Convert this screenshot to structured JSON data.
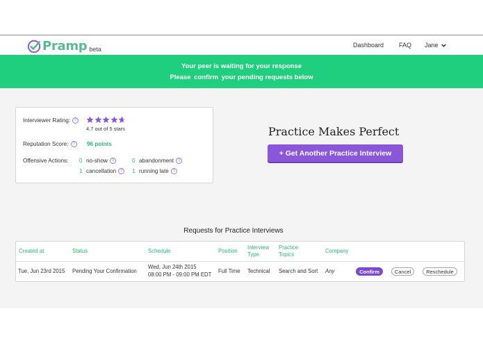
{
  "colors": {
    "brand_green": "#1fcf7d",
    "accent_purple": "#8a57d8",
    "link_green": "#2ab673"
  },
  "nav": {
    "logo_text": "Pramp",
    "logo_badge": "beta",
    "dashboard": "Dashboard",
    "faq": "FAQ",
    "user": "Jane",
    "user_icon": "chevron-down-icon"
  },
  "banner": {
    "line1": "Your peer is waiting for your response",
    "line2_prefix": "Please",
    "line2_link": "confirm",
    "line2_suffix": "your pending requests below"
  },
  "stats": {
    "rating_label": "Interviewer Rating:",
    "rating_stars": 4.7,
    "rating_max": 5,
    "rating_text": "4.7 out of 5 stars",
    "reputation_label": "Reputation Score:",
    "reputation_value": "96 points",
    "offensive_label": "Offensive Actions:",
    "offenses": [
      {
        "count": "0",
        "label": "no-show"
      },
      {
        "count": "0",
        "label": "abandonment"
      },
      {
        "count": "1",
        "label": "cancellation"
      },
      {
        "count": "1",
        "label": "running late"
      }
    ],
    "help_glyph": "?"
  },
  "hero": {
    "title": "Practice Makes Perfect",
    "cta": "+ Get Another Practice Interview"
  },
  "requests": {
    "title": "Requests for Practice Interviews",
    "columns": {
      "created_at": "Created at",
      "status": "Status",
      "schedule": "Schedule",
      "position": "Position",
      "interview_type_1": "Interview",
      "interview_type_2": "Type",
      "practice_topics_1": "Practice",
      "practice_topics_2": "Topics",
      "company": "Company"
    },
    "rows": [
      {
        "created_at": "Tue, Jun 23rd 2015",
        "status": "Pending Your Confirmation",
        "schedule_date": "Wed, Jun 24th 2015",
        "schedule_time": "08:00 PM - 09:00 PM EDT",
        "position": "Full Time",
        "interview_type": "Technical",
        "practice_topics": "Search and Sort",
        "company": "Any",
        "confirm": "Confirm",
        "cancel": "Cancel",
        "reschedule": "Reschedule"
      }
    ]
  }
}
